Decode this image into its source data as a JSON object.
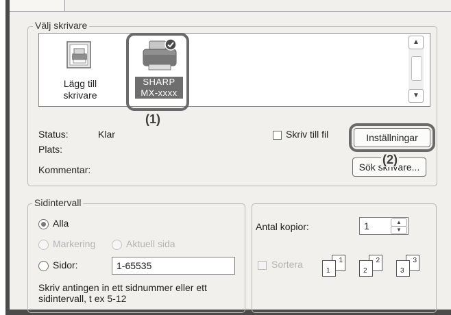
{
  "printer_group": {
    "legend": "Välj skrivare",
    "items": [
      {
        "label_line1": "Lägg till",
        "label_line2": "skrivare",
        "icon": "add-printer-icon"
      },
      {
        "label_line1": "SHARP",
        "label_line2": "MX-xxxx",
        "icon": "printer-icon",
        "selected": true,
        "default_badge": "checkmark-badge-icon"
      }
    ]
  },
  "callouts": {
    "one": "(1)",
    "two": "(2)"
  },
  "status": {
    "status_label": "Status:",
    "status_value": "Klar",
    "location_label": "Plats:",
    "comment_label": "Kommentar:"
  },
  "print_to_file": {
    "label": "Skriv till fil",
    "checked": false
  },
  "buttons": {
    "settings": "Inställningar",
    "find_printer": "Sök skrivare..."
  },
  "range_group": {
    "legend": "Sidintervall",
    "all": "Alla",
    "selection": "Markering",
    "current_page": "Aktuell sida",
    "pages": "Sidor:",
    "pages_value": "1-65535",
    "hint": "Skriv antingen in ett sidnummer eller ett sidintervall, t ex 5-12",
    "selected_option": "Alla"
  },
  "copies": {
    "label": "Antal kopior:",
    "value": "1",
    "collate_label": "Sortera",
    "collate_checked": false,
    "collate_pages": [
      "1",
      "2",
      "3"
    ]
  },
  "colors": {
    "dialog_bg": "#f1f0ec",
    "highlight": "#6a6a6a",
    "selected_label_bg": "#6e6e6e"
  }
}
